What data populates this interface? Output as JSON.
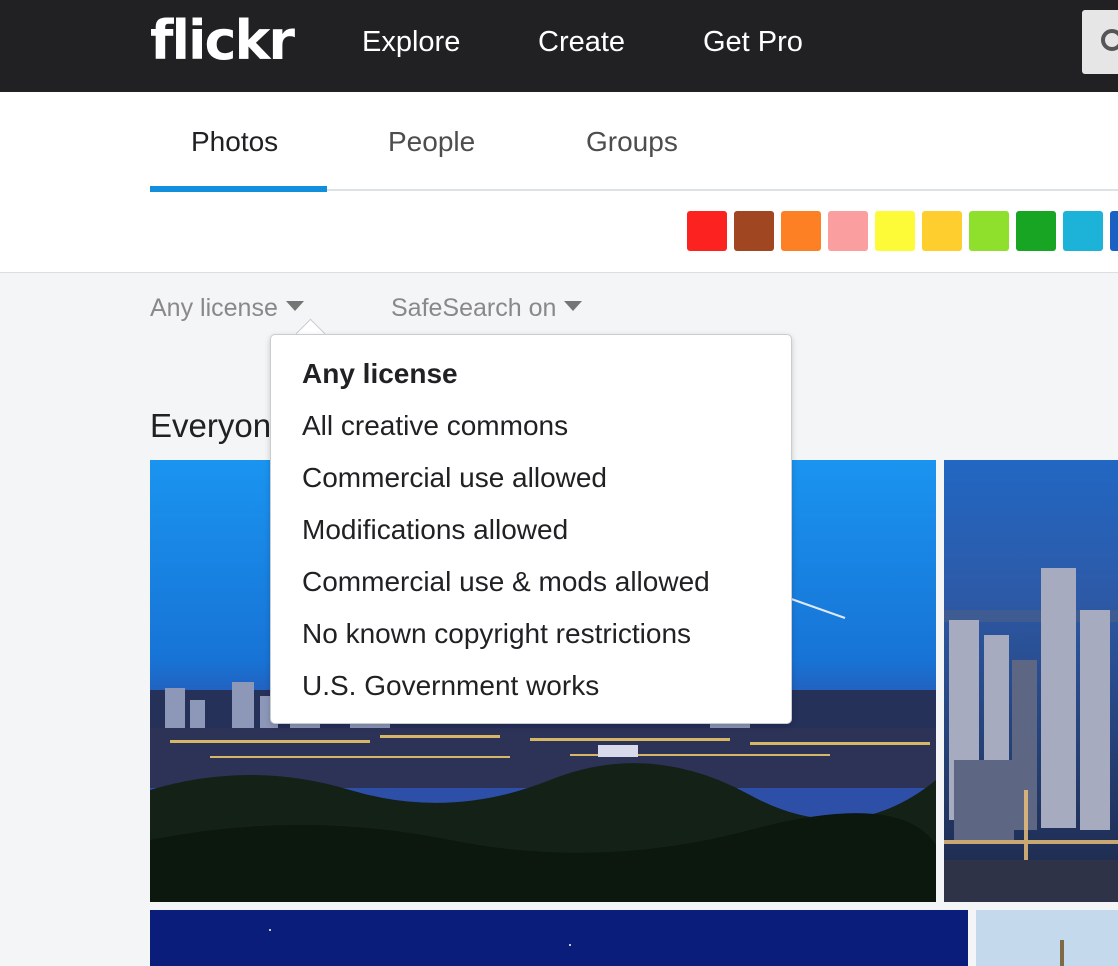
{
  "topnav": {
    "logo": "flickr",
    "links": [
      "Explore",
      "Create",
      "Get Pro"
    ]
  },
  "search": {
    "icon": "search-icon"
  },
  "tabs": [
    {
      "label": "Photos",
      "active": true
    },
    {
      "label": "People",
      "active": false
    },
    {
      "label": "Groups",
      "active": false
    }
  ],
  "color_swatches": [
    "#fb2220",
    "#a04621",
    "#fd8124",
    "#fb9ea0",
    "#fdfa37",
    "#fece2f",
    "#8fe02d",
    "#18a524",
    "#1db2d8",
    "#1b61c3"
  ],
  "filters": {
    "license": "Any license",
    "safesearch": "SafeSearch on"
  },
  "section_title": "Everyone's photos",
  "license_menu": {
    "items": [
      "Any license",
      "All creative commons",
      "Commercial use allowed",
      "Modifications allowed",
      "Commercial use & mods allowed",
      "No known copyright restrictions",
      "U.S. Government works"
    ],
    "selected_index": 0
  }
}
